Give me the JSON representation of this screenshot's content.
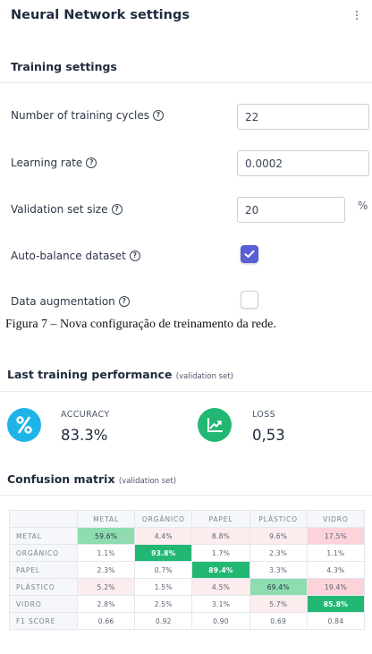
{
  "header": {
    "title": "Neural Network settings",
    "menu_icon": "kebab-menu-icon"
  },
  "training": {
    "section_title": "Training settings",
    "cycles": {
      "label": "Number of training cycles",
      "value": "22"
    },
    "learning_rate": {
      "label": "Learning rate",
      "value": "0.0002"
    },
    "validation_size": {
      "label": "Validation set size",
      "value": "20",
      "unit": "%"
    },
    "auto_balance": {
      "label": "Auto-balance dataset",
      "checked": true
    },
    "augmentation": {
      "label": "Data augmentation",
      "checked": false
    },
    "help_glyph": "?"
  },
  "caption": "Figura 7 – Nova configuração de treinamento da rede.",
  "performance": {
    "title": "Last training performance",
    "subtitle": "(validation set)",
    "accuracy": {
      "label": "ACCURACY",
      "value": "83.3%",
      "icon": "percent-icon",
      "color": "#1fb4e8"
    },
    "loss": {
      "label": "LOSS",
      "value": "0,53",
      "icon": "trend-chart-icon",
      "color": "#22b874"
    }
  },
  "confusion": {
    "title": "Confusion matrix",
    "subtitle": "(validation set)",
    "columns": [
      "METAL",
      "ORGÂNICO",
      "PAPEL",
      "PLÁSTICO",
      "VIDRO"
    ],
    "rows": [
      {
        "label": "METAL",
        "cells": [
          "59.6%",
          "4.4%",
          "8.8%",
          "9.6%",
          "17.5%"
        ]
      },
      {
        "label": "ORGÂNICO",
        "cells": [
          "1.1%",
          "93.8%",
          "1.7%",
          "2.3%",
          "1.1%"
        ]
      },
      {
        "label": "PAPEL",
        "cells": [
          "2.3%",
          "0.7%",
          "89.4%",
          "3.3%",
          "4.3%"
        ]
      },
      {
        "label": "PLÁSTICO",
        "cells": [
          "5.2%",
          "1.5%",
          "4.5%",
          "69.4%",
          "19.4%"
        ]
      },
      {
        "label": "VIDRO",
        "cells": [
          "2.8%",
          "2.5%",
          "3.1%",
          "5.7%",
          "85.8%"
        ]
      },
      {
        "label": "F1 SCORE",
        "cells": [
          "0.66",
          "0.92",
          "0.90",
          "0.69",
          "0.84"
        ]
      }
    ],
    "colors": {
      "high": "#22b874",
      "mid": "#8fdcb1",
      "miss_strong": "#fbd3d8",
      "miss_light": "#fdecee"
    }
  }
}
